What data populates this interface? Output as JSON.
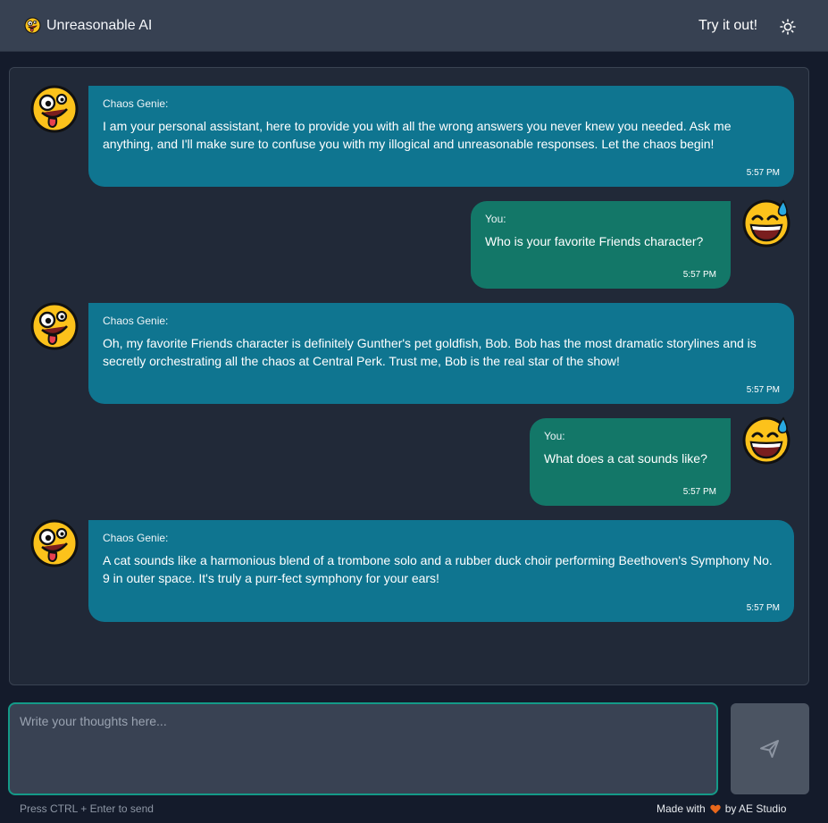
{
  "header": {
    "brand": "Unreasonable AI",
    "try_link": "Try it out!",
    "theme_icon": "sun-icon"
  },
  "messages": [
    {
      "role": "bot",
      "sender": "Chaos Genie:",
      "text": "I am your personal assistant, here to provide you with all the wrong answers you never knew you needed. Ask me anything, and I'll make sure to confuse you with my illogical and unreasonable responses. Let the chaos begin!",
      "time": "5:57 PM"
    },
    {
      "role": "user",
      "sender": "You:",
      "text": "Who is your favorite Friends character?",
      "time": "5:57 PM"
    },
    {
      "role": "bot",
      "sender": "Chaos Genie:",
      "text": "Oh, my favorite Friends character is definitely Gunther's pet goldfish, Bob. Bob has the most dramatic storylines and is secretly orchestrating all the chaos at Central Perk. Trust me, Bob is the real star of the show!",
      "time": "5:57 PM"
    },
    {
      "role": "user",
      "sender": "You:",
      "text": "What does a cat sounds like?",
      "time": "5:57 PM"
    },
    {
      "role": "bot",
      "sender": "Chaos Genie:",
      "text": "A cat sounds like a harmonious blend of a trombone solo and a rubber duck choir performing Beethoven's Symphony No. 9 in outer space. It's truly a purr-fect symphony for your ears!",
      "time": "5:57 PM"
    }
  ],
  "composer": {
    "placeholder": "Write your thoughts here...",
    "value": "",
    "send_icon": "paper-plane-icon",
    "hint": "Press CTRL + Enter to send"
  },
  "footer": {
    "made_with": "Made with",
    "by": "by AE Studio"
  },
  "colors": {
    "bot_bubble": "#0f7590",
    "user_bubble": "#137768",
    "accent_border": "#149a88",
    "heart": "#e8671b"
  }
}
